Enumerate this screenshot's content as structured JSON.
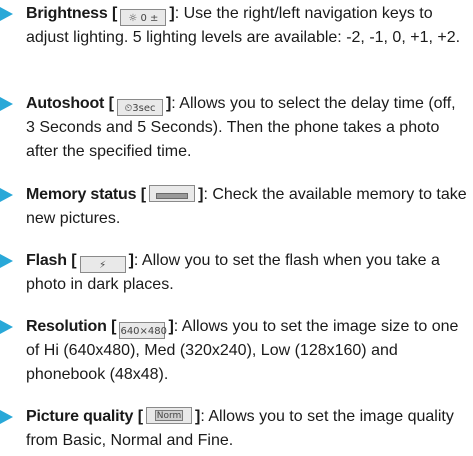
{
  "items": [
    {
      "term": "Brightness",
      "icon_label": "☼ 0 ±",
      "desc": ": Use the right/left navigation keys to adjust lighting. 5 lighting levels are available: -2, -1, 0, +1, +2."
    },
    {
      "term": "Autoshoot",
      "icon_label": "⏲3sec",
      "desc": ": Allows you to select the delay time (off, 3 Seconds and 5 Seconds). Then the phone takes a photo after the specified time."
    },
    {
      "term": "Memory status",
      "icon_label": "",
      "desc": ": Check the available memory to take new pictures."
    },
    {
      "term": "Flash",
      "icon_label": "⚡",
      "desc": ": Allow you to set the flash when you take a photo in dark places."
    },
    {
      "term": "Resolution",
      "icon_label": "640×480",
      "desc": ": Allows you to set the image size to one of Hi (640x480), Med (320x240), Low (128x160) and phonebook (48x48)."
    },
    {
      "term": "Picture quality",
      "icon_label": "Norm",
      "desc": ": Allows you to set the image quality from Basic, Normal and Fine."
    }
  ],
  "colors": {
    "bullet": "#29a8d8",
    "text": "#1a1a1a"
  }
}
